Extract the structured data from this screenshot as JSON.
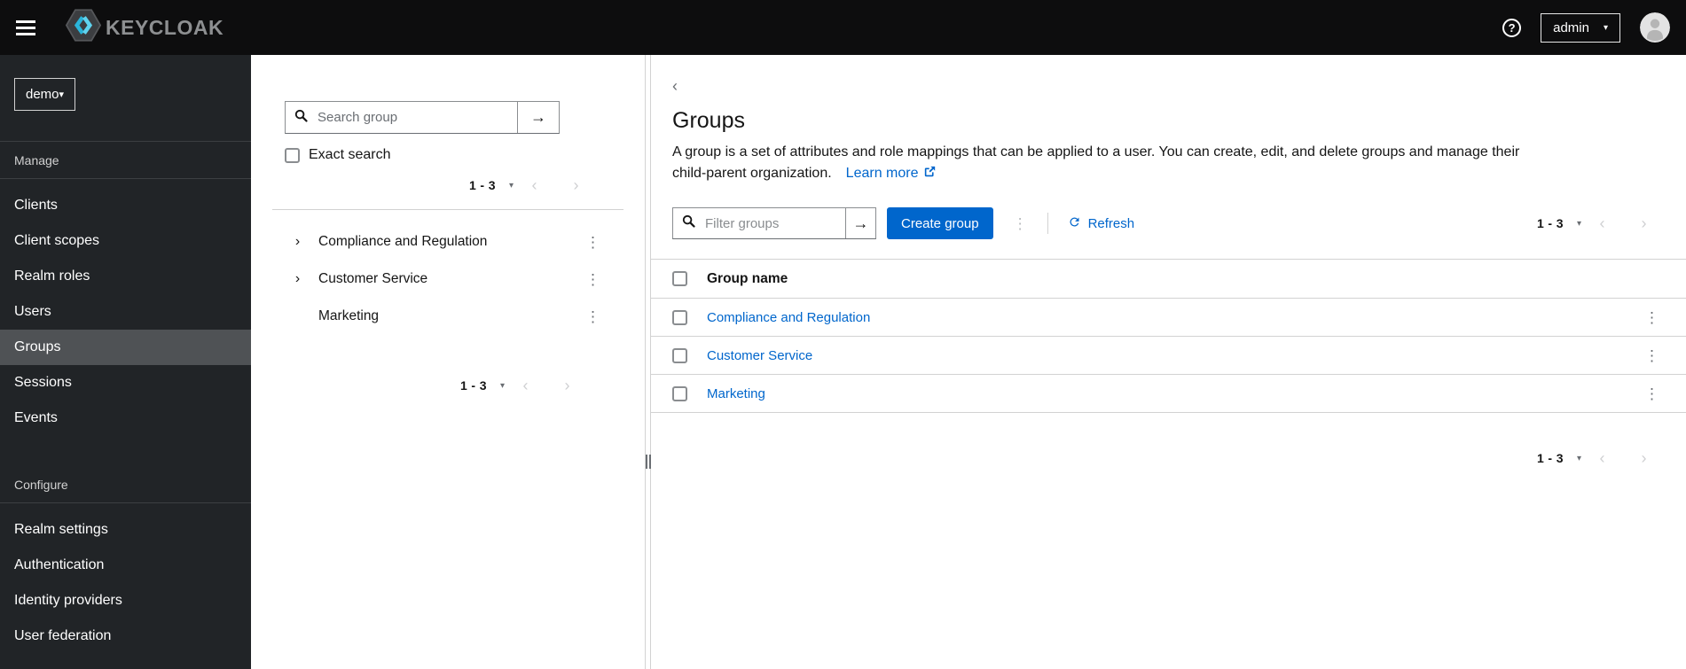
{
  "topbar": {
    "brand_text": "KEYCLOAK",
    "admin_menu_label": "admin"
  },
  "sidebar": {
    "realm_selector_value": "demo",
    "sections": [
      {
        "label": "Manage",
        "items": [
          {
            "label": "Clients"
          },
          {
            "label": "Client scopes"
          },
          {
            "label": "Realm roles"
          },
          {
            "label": "Users"
          },
          {
            "label": "Groups",
            "active": true
          },
          {
            "label": "Sessions"
          },
          {
            "label": "Events"
          }
        ]
      },
      {
        "label": "Configure",
        "items": [
          {
            "label": "Realm settings"
          },
          {
            "label": "Authentication"
          },
          {
            "label": "Identity providers"
          },
          {
            "label": "User federation"
          }
        ]
      }
    ]
  },
  "groups_panel": {
    "search_placeholder": "Search group",
    "exact_search_label": "Exact search",
    "pagination_range_top": "1 - 3",
    "pagination_range_bottom": "1 - 3",
    "tree_items": [
      {
        "label": "Compliance and Regulation",
        "expandable": true
      },
      {
        "label": "Customer Service",
        "expandable": true
      },
      {
        "label": "Marketing",
        "expandable": false
      }
    ]
  },
  "main": {
    "title": "Groups",
    "description_line1": "A group is a set of attributes and role mappings that can be applied to a user. You can create, edit, and delete groups and manage their",
    "description_line2": "child-parent organization.",
    "learn_more_label": "Learn more",
    "toolbar": {
      "filter_placeholder": "Filter groups",
      "create_button_label": "Create group",
      "refresh_label": "Refresh",
      "pagination_range": "1 - 3"
    },
    "table": {
      "header": "Group name",
      "rows": [
        {
          "name": "Compliance and Regulation"
        },
        {
          "name": "Customer Service"
        },
        {
          "name": "Marketing"
        }
      ]
    },
    "pagination_range_bottom": "1 - 3"
  },
  "icons": {
    "arrow_right": "→",
    "caret_down": "▾",
    "chevron_left": "‹",
    "chevron_right": "›",
    "kebab": "⋮",
    "tree_expand": "›",
    "back": "‹",
    "help": "?"
  },
  "colors": {
    "accent_blue": "#0066cc",
    "topbar_bg": "#0d0d0e",
    "sidebar_bg": "#212427",
    "sidebar_active_bg": "#4f5255",
    "border_gray": "#d2d2d2",
    "text_dark": "#151515"
  }
}
